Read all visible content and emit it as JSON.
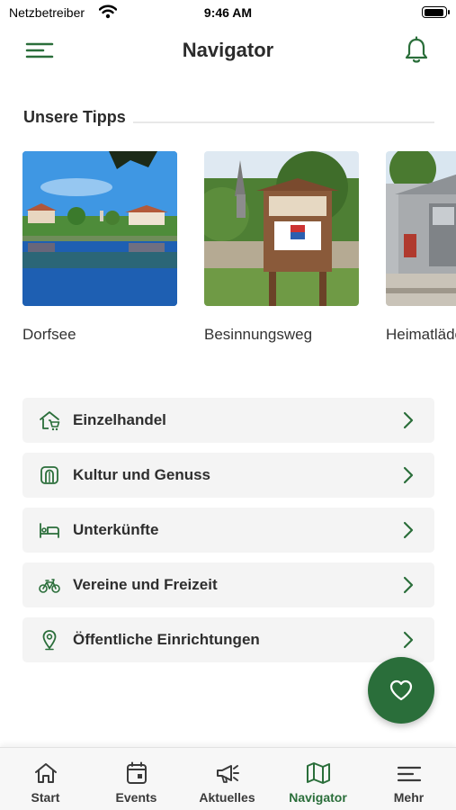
{
  "status_bar": {
    "carrier": "Netzbetreiber",
    "time": "9:46 AM"
  },
  "header": {
    "title": "Navigator"
  },
  "tips": {
    "heading": "Unsere Tipps",
    "items": [
      {
        "label": "Dorfsee"
      },
      {
        "label": "Besinnungsweg"
      },
      {
        "label": "Heimatläden"
      }
    ]
  },
  "categories": [
    {
      "label": "Einzelhandel",
      "icon": "shop-icon"
    },
    {
      "label": "Kultur und Genuss",
      "icon": "culture-icon"
    },
    {
      "label": "Unterkünfte",
      "icon": "bed-icon"
    },
    {
      "label": "Vereine und Freizeit",
      "icon": "bicycle-icon"
    },
    {
      "label": "Öffentliche Einrichtungen",
      "icon": "location-pin-icon"
    }
  ],
  "tabbar": {
    "active": "Navigator",
    "tabs": [
      {
        "label": "Start",
        "icon": "home-icon"
      },
      {
        "label": "Events",
        "icon": "calendar-icon"
      },
      {
        "label": "Aktuelles",
        "icon": "megaphone-icon"
      },
      {
        "label": "Navigator",
        "icon": "map-icon"
      },
      {
        "label": "Mehr",
        "icon": "menu-icon"
      }
    ]
  },
  "colors": {
    "accent": "#2a6e3a",
    "card_bg": "#f4f4f4",
    "text": "#2e2e2e"
  }
}
